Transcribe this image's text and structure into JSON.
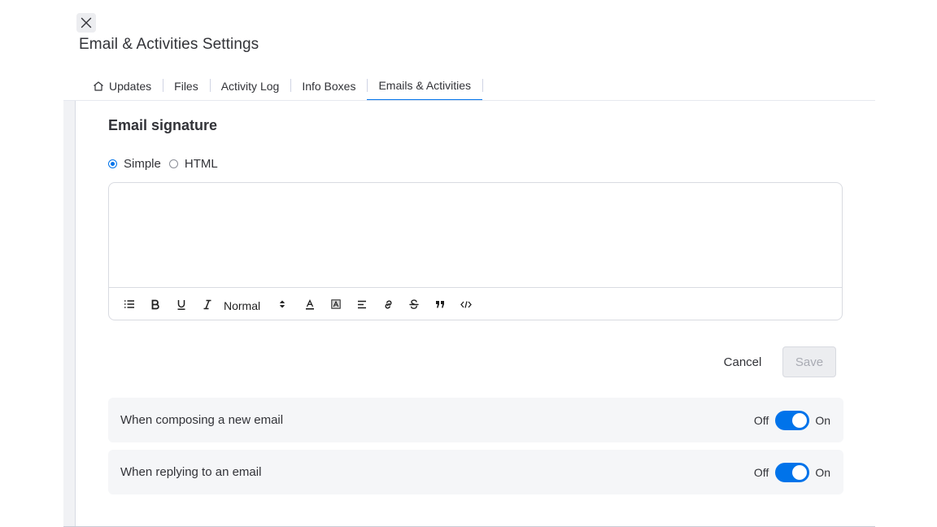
{
  "dialog": {
    "title": "Email & Activities Settings"
  },
  "tabs": [
    {
      "label": "Updates",
      "icon": "home-icon"
    },
    {
      "label": "Files"
    },
    {
      "label": "Activity Log"
    },
    {
      "label": "Info Boxes"
    },
    {
      "label": "Emails & Activities",
      "active": true
    }
  ],
  "signature": {
    "title": "Email signature",
    "mode_options": [
      "Simple",
      "HTML"
    ],
    "selected_mode": "Simple",
    "editor_value": "",
    "toolbar": {
      "heading_select": "Normal",
      "tools": [
        "list-icon",
        "bold-icon",
        "underline-icon",
        "italic-icon",
        "font-color-icon",
        "background-color-icon",
        "align-icon",
        "link-icon",
        "strikethrough-icon",
        "blockquote-icon",
        "code-icon"
      ]
    },
    "cancel_label": "Cancel",
    "save_label": "Save"
  },
  "settings": [
    {
      "label": "When composing a new email",
      "off_label": "Off",
      "on_label": "On",
      "enabled": true
    },
    {
      "label": "When replying to an email",
      "off_label": "Off",
      "on_label": "On",
      "enabled": true
    }
  ],
  "colors": {
    "accent": "#0073ea",
    "text": "#323338",
    "row_bg": "#f5f6f8"
  }
}
